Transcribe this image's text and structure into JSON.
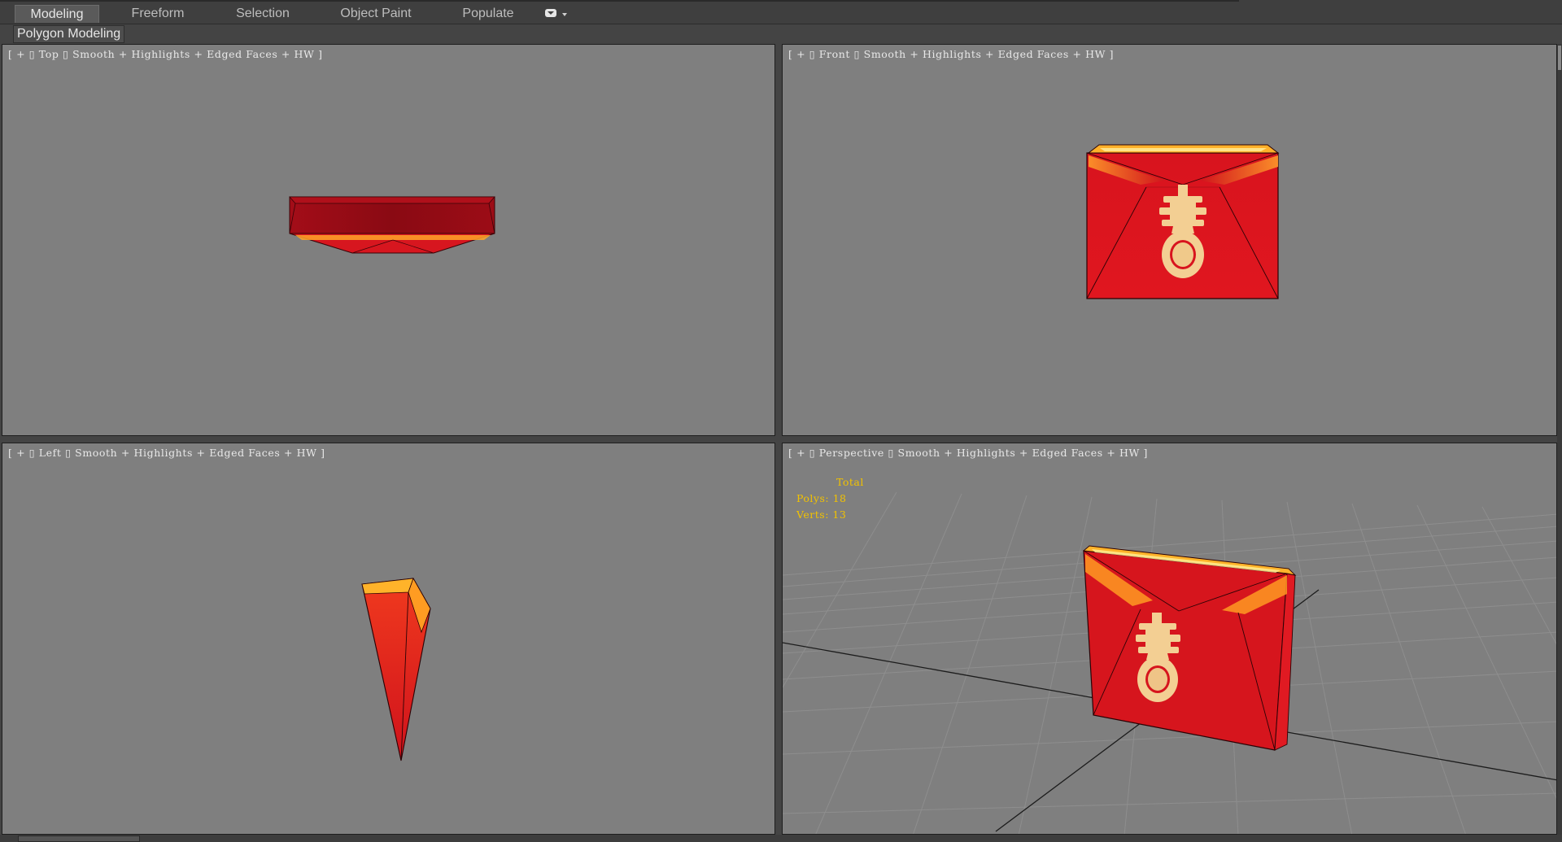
{
  "ribbon": {
    "tabs": [
      {
        "label": "Modeling",
        "active": true
      },
      {
        "label": "Freeform",
        "active": false
      },
      {
        "label": "Selection",
        "active": false
      },
      {
        "label": "Object Paint",
        "active": false
      },
      {
        "label": "Populate",
        "active": false
      }
    ],
    "options_icon": "ribbon-options-dropdown-icon",
    "panel_label": "Polygon Modeling"
  },
  "viewports": {
    "top": {
      "open": "[ ",
      "plus": "+",
      "view": "Top",
      "shading": "Smooth + Highlights + Edged Faces + HW",
      "close": " ]"
    },
    "front": {
      "open": "[ ",
      "plus": "+",
      "view": "Front",
      "shading": "Smooth + Highlights + Edged Faces + HW",
      "close": " ]"
    },
    "left": {
      "open": "[ ",
      "plus": "+",
      "view": "Left",
      "shading": "Smooth + Highlights + Edged Faces + HW",
      "close": " ]"
    },
    "perspective": {
      "open": "[ ",
      "plus": "+",
      "view": "Perspective",
      "shading": "Smooth + Highlights + Edged Faces + HW",
      "close": " ]",
      "stats": {
        "total": "Total",
        "polys": "Polys: 18",
        "verts": "Verts: 13"
      }
    }
  },
  "colors": {
    "viewport_bg": "#7f7f7f",
    "model_red": "#d3131c",
    "model_dark_red": "#8c0a14",
    "highlight_orange": "#ffb020",
    "emblem_cream": "#f4d49a",
    "stats_yellow": "#f2c200"
  }
}
